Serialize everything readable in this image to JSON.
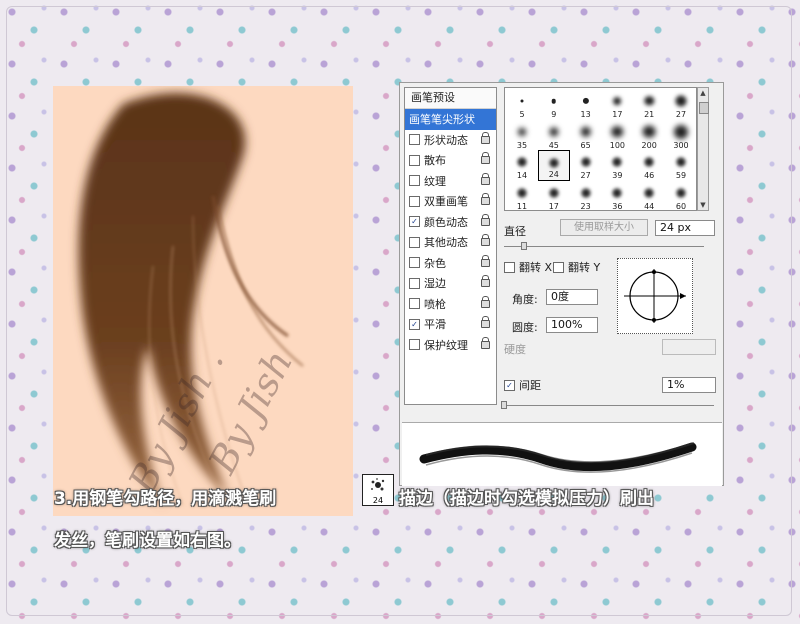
{
  "panel": {
    "preset_label": "画笔预设",
    "options": [
      {
        "label": "画笔笔尖形状",
        "checkbox": false,
        "checked": false,
        "lock": false,
        "selected": true
      },
      {
        "label": "形状动态",
        "checkbox": true,
        "checked": false,
        "lock": true
      },
      {
        "label": "散布",
        "checkbox": true,
        "checked": false,
        "lock": true
      },
      {
        "label": "纹理",
        "checkbox": true,
        "checked": false,
        "lock": true
      },
      {
        "label": "双重画笔",
        "checkbox": true,
        "checked": false,
        "lock": true
      },
      {
        "label": "颜色动态",
        "checkbox": true,
        "checked": true,
        "lock": true
      },
      {
        "label": "其他动态",
        "checkbox": true,
        "checked": false,
        "lock": true
      },
      {
        "label": "杂色",
        "checkbox": true,
        "checked": false,
        "lock": true
      },
      {
        "label": "湿边",
        "checkbox": true,
        "checked": false,
        "lock": true
      },
      {
        "label": "喷枪",
        "checkbox": true,
        "checked": false,
        "lock": true
      },
      {
        "label": "平滑",
        "checkbox": true,
        "checked": true,
        "lock": true
      },
      {
        "label": "保护纹理",
        "checkbox": true,
        "checked": false,
        "lock": true
      }
    ],
    "tips": [
      "5",
      "9",
      "13",
      "17",
      "21",
      "27",
      "35",
      "45",
      "65",
      "100",
      "200",
      "300",
      "14",
      "24",
      "27",
      "39",
      "46",
      "59",
      "11",
      "17",
      "23",
      "36",
      "44",
      "60"
    ],
    "selected_tip_index": 13,
    "diameter_label": "直径",
    "use_sample_size": "使用取样大小",
    "diameter_value": "24 px",
    "flip_x": "翻转 X",
    "flip_y": "翻转 Y",
    "angle_label": "角度:",
    "angle_value": "0度",
    "roundness_label": "圆度:",
    "roundness_value": "100%",
    "hardness_label": "硬度",
    "spacing_label": "间距",
    "spacing_checked": true,
    "spacing_value": "1%",
    "check_mark": "✓"
  },
  "caption": {
    "line1_part1": "3.用钢笔勾路径，用滴溅笔刷",
    "line1_part2": "描边（描边时勾选模拟压力）刷出",
    "line2": "发丝，笔刷设置如右图。",
    "brush_size": "24"
  },
  "watermarks": [
    "By Jish .",
    "By Jish"
  ]
}
